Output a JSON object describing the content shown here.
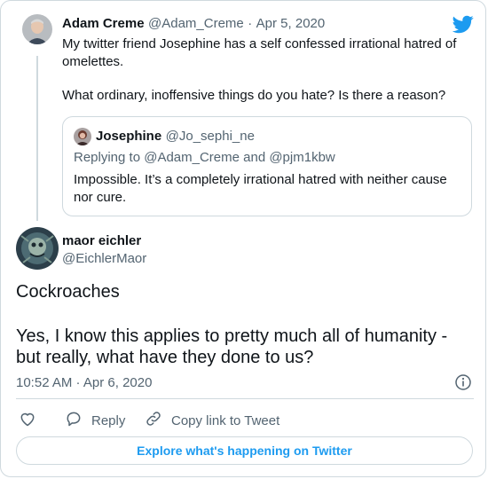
{
  "quoted_tweet": {
    "author_name": "Adam Creme",
    "author_handle": "@Adam_Creme",
    "separator": "·",
    "date": "Apr 5, 2020",
    "text_line1": "My twitter friend Josephine has a self confessed irrational hatred of",
    "text_line2": "omelettes.",
    "text_line3": "What ordinary, inoffensive things do you hate? Is there a reason?"
  },
  "nested_quote": {
    "author_name": "Josephine",
    "author_handle": "@Jo_sephi_ne",
    "replying_to": "Replying to @Adam_Creme and @pjm1kbw",
    "text_line1": "Impossible. It’s a completely irrational hatred with neither cause",
    "text_line2": "nor cure."
  },
  "main_tweet": {
    "author_name": "maor eichler",
    "author_handle": "@EichlerMaor",
    "text_line1": "Cockroaches",
    "text_line2": "Yes, I know this applies to pretty much all of humanity -",
    "text_line3": "but really, what have they done to us?",
    "timestamp": "10:52 AM · Apr 6, 2020"
  },
  "actions": {
    "reply_label": "Reply",
    "copy_link_label": "Copy link to Tweet"
  },
  "footer": {
    "explore_label": "Explore what's happening on Twitter"
  },
  "icons": {
    "twitter_logo": "twitter-bird-icon",
    "info": "info-icon",
    "like": "heart-icon",
    "reply": "reply-bubble-icon",
    "copy_link": "link-icon"
  },
  "colors": {
    "brand_blue": "#1d9bf0",
    "border": "#cfd9de",
    "muted_text": "#536471"
  }
}
